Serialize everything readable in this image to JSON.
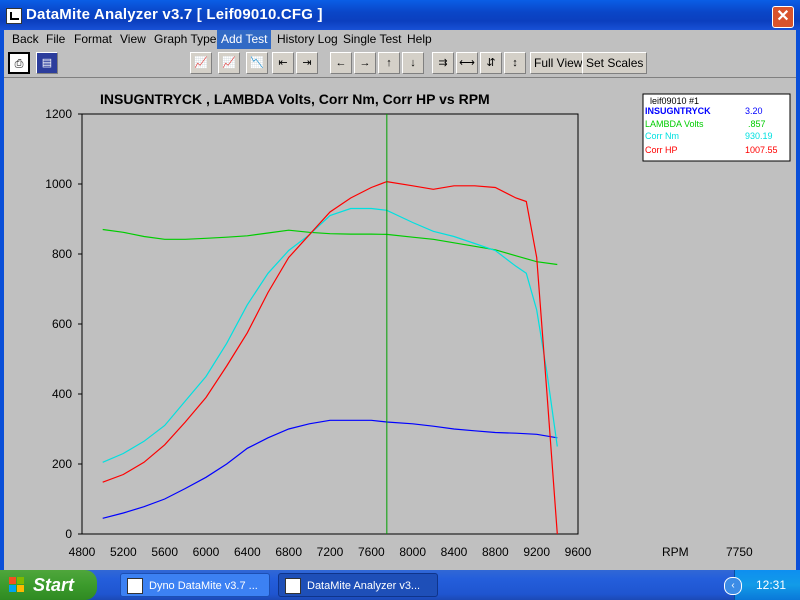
{
  "window": {
    "title": "DataMite Analyzer v3.7  [ Leif09010.CFG ]",
    "close_glyph": "✕"
  },
  "menu": {
    "items": [
      "Back",
      "File",
      "Format",
      "View",
      "Graph Type",
      "Add Test",
      "History Log",
      "Single Test",
      "Help"
    ],
    "active": "Add Test"
  },
  "toolbar": {
    "full_view": "Full View",
    "set_scales": "Set Scales"
  },
  "chart": {
    "title": "INSUGNTRYCK , LAMBDA Volts, Corr Nm, Corr HP vs RPM"
  },
  "legend": {
    "header": "leif09010   #1",
    "entries": [
      {
        "name": "INSUGNTRYCK",
        "value": "3.20",
        "color": "#0000ff"
      },
      {
        "name": "LAMBDA Volts",
        "value": ".857",
        "color": "#00cc00"
      },
      {
        "name": "Corr Nm",
        "value": "930.19",
        "color": "#00e0e0"
      },
      {
        "name": "Corr HP",
        "value": "1007.55",
        "color": "#ff0000"
      }
    ]
  },
  "cursor": {
    "label": "RPM",
    "value": "7750"
  },
  "chart_data": {
    "type": "line",
    "title": "INSUGNTRYCK , LAMBDA Volts, Corr Nm, Corr HP vs RPM",
    "xlim": [
      4800,
      9600
    ],
    "ylim": [
      0,
      1200
    ],
    "x_ticks": [
      4800,
      5200,
      5600,
      6000,
      6400,
      6800,
      7200,
      7600,
      8000,
      8400,
      8800,
      9200,
      9600
    ],
    "y_ticks": [
      0,
      200,
      400,
      600,
      800,
      1000,
      1200
    ],
    "grid": true,
    "legend_position": "top-right",
    "cursor_x": 7750,
    "series": [
      {
        "name": "INSUGNTRYCK",
        "color": "#0000ff",
        "points": [
          [
            5000,
            45
          ],
          [
            5200,
            60
          ],
          [
            5400,
            78
          ],
          [
            5600,
            100
          ],
          [
            5800,
            130
          ],
          [
            6000,
            162
          ],
          [
            6200,
            200
          ],
          [
            6400,
            245
          ],
          [
            6600,
            275
          ],
          [
            6800,
            300
          ],
          [
            7000,
            315
          ],
          [
            7200,
            325
          ],
          [
            7400,
            325
          ],
          [
            7600,
            325
          ],
          [
            7750,
            320
          ],
          [
            8000,
            315
          ],
          [
            8200,
            308
          ],
          [
            8400,
            300
          ],
          [
            8600,
            295
          ],
          [
            8800,
            290
          ],
          [
            9000,
            288
          ],
          [
            9200,
            285
          ],
          [
            9400,
            275
          ]
        ]
      },
      {
        "name": "LAMBDA Volts",
        "color": "#00cc00",
        "points": [
          [
            5000,
            870
          ],
          [
            5200,
            862
          ],
          [
            5400,
            850
          ],
          [
            5600,
            842
          ],
          [
            5800,
            842
          ],
          [
            6000,
            845
          ],
          [
            6200,
            848
          ],
          [
            6400,
            852
          ],
          [
            6600,
            860
          ],
          [
            6800,
            868
          ],
          [
            7000,
            862
          ],
          [
            7200,
            858
          ],
          [
            7400,
            857
          ],
          [
            7600,
            857
          ],
          [
            7750,
            856
          ],
          [
            8000,
            848
          ],
          [
            8200,
            842
          ],
          [
            8400,
            832
          ],
          [
            8600,
            822
          ],
          [
            8800,
            812
          ],
          [
            9000,
            795
          ],
          [
            9200,
            778
          ],
          [
            9400,
            770
          ]
        ]
      },
      {
        "name": "Corr Nm",
        "color": "#00e0e0",
        "points": [
          [
            5000,
            205
          ],
          [
            5200,
            230
          ],
          [
            5400,
            265
          ],
          [
            5600,
            310
          ],
          [
            5800,
            380
          ],
          [
            6000,
            450
          ],
          [
            6200,
            545
          ],
          [
            6400,
            655
          ],
          [
            6600,
            745
          ],
          [
            6800,
            810
          ],
          [
            7000,
            855
          ],
          [
            7200,
            910
          ],
          [
            7400,
            930
          ],
          [
            7600,
            930
          ],
          [
            7750,
            925
          ],
          [
            8000,
            890
          ],
          [
            8200,
            865
          ],
          [
            8400,
            850
          ],
          [
            8600,
            830
          ],
          [
            8800,
            810
          ],
          [
            9000,
            765
          ],
          [
            9100,
            745
          ],
          [
            9200,
            640
          ],
          [
            9300,
            460
          ],
          [
            9400,
            250
          ]
        ]
      },
      {
        "name": "Corr HP",
        "color": "#ff0000",
        "points": [
          [
            5000,
            148
          ],
          [
            5200,
            170
          ],
          [
            5400,
            205
          ],
          [
            5600,
            255
          ],
          [
            5800,
            320
          ],
          [
            6000,
            390
          ],
          [
            6200,
            480
          ],
          [
            6400,
            575
          ],
          [
            6600,
            690
          ],
          [
            6800,
            790
          ],
          [
            7000,
            855
          ],
          [
            7200,
            920
          ],
          [
            7400,
            960
          ],
          [
            7600,
            990
          ],
          [
            7750,
            1007
          ],
          [
            8000,
            995
          ],
          [
            8200,
            985
          ],
          [
            8400,
            995
          ],
          [
            8600,
            995
          ],
          [
            8800,
            990
          ],
          [
            9000,
            960
          ],
          [
            9100,
            950
          ],
          [
            9200,
            790
          ],
          [
            9300,
            400
          ],
          [
            9400,
            0
          ]
        ]
      }
    ]
  }
}
